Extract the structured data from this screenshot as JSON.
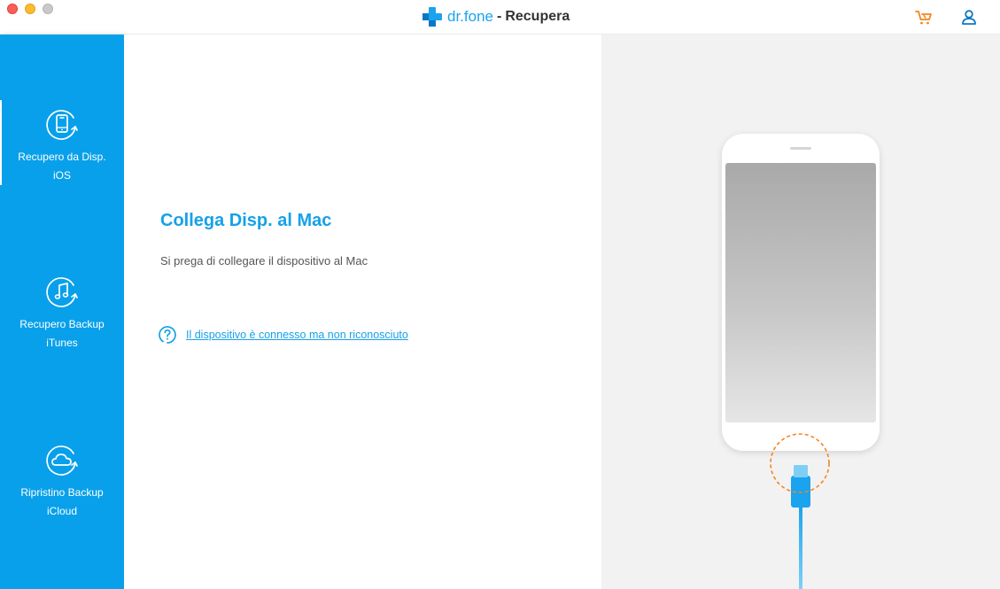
{
  "window": {
    "brand_name": "dr.fone",
    "brand_separator": "-",
    "section_title": "Recupera"
  },
  "toolbar": {
    "cart_icon": "cart-icon",
    "user_icon": "user-icon",
    "cart_color": "#f5841f",
    "user_color": "#0d77c4"
  },
  "sidebar": {
    "accent": "#08a0ea",
    "items": [
      {
        "label": "Recupero da Disp. iOS",
        "icon": "phone-recover-icon",
        "active": true
      },
      {
        "label": "Recupero Backup iTunes",
        "icon": "itunes-music-icon",
        "active": false
      },
      {
        "label": "Ripristino Backup iCloud",
        "icon": "icloud-icon",
        "active": false
      }
    ]
  },
  "main": {
    "title": "Collega Disp. al Mac",
    "subtitle": "Si prega di collegare il dispositivo al Mac",
    "help_link": "Il dispositivo è connesso ma non riconosciuto",
    "help_icon": "question-circle-icon",
    "title_color": "#16a1e8"
  },
  "device": {
    "highlight_color": "#f5841f",
    "cable_color": "#1aa3ee"
  }
}
